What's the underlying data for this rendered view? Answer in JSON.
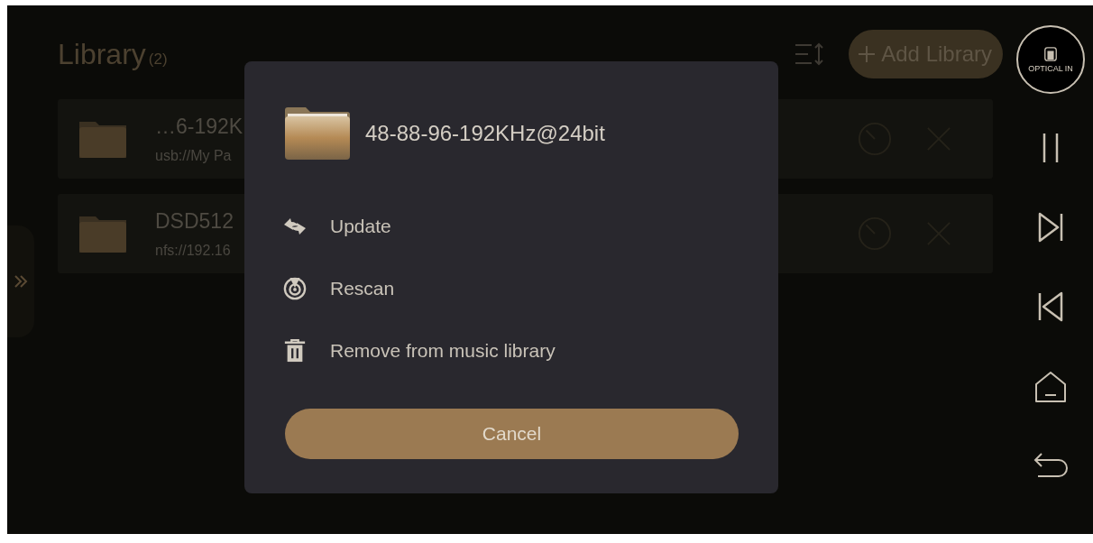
{
  "library": {
    "title": "Library",
    "count": "(2)",
    "add_button": "Add Library",
    "items": [
      {
        "name": "…6-192K",
        "path": "usb://My Pa"
      },
      {
        "name": "DSD512",
        "path": "nfs://192.16"
      }
    ]
  },
  "input_badge": {
    "label": "OPTICAL IN"
  },
  "dialog": {
    "title": "48-88-96-192KHz@24bit",
    "actions": [
      {
        "kind": "update",
        "label": "Update"
      },
      {
        "kind": "rescan",
        "label": "Rescan"
      },
      {
        "kind": "remove",
        "label": "Remove from music library"
      }
    ],
    "cancel": "Cancel"
  }
}
